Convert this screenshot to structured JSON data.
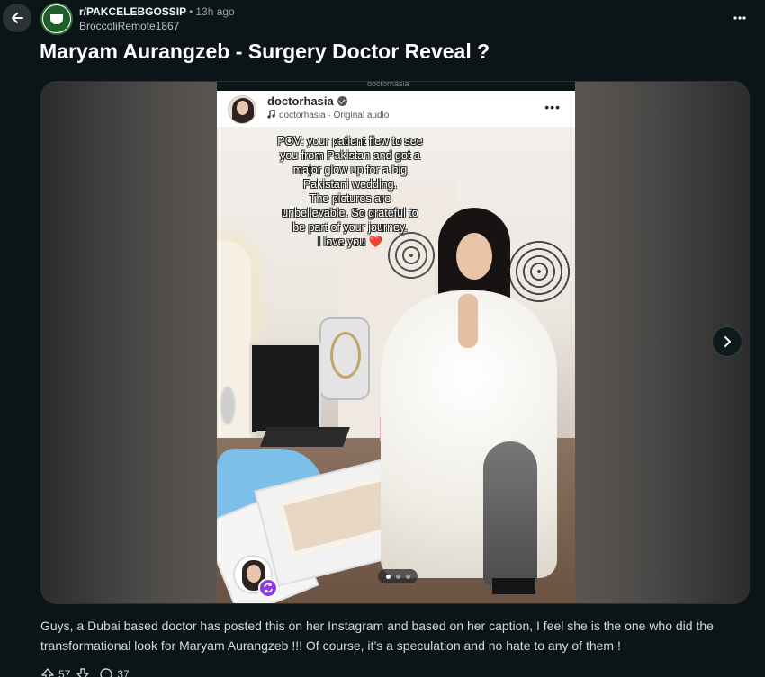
{
  "header": {
    "subreddit": "r/PAKCELEBGOSSIP",
    "separator": "•",
    "time": "13h ago",
    "author": "BroccoliRemote1867"
  },
  "post": {
    "title": "Maryam Aurangzeb - Surgery Doctor Reveal ?",
    "body": "Guys, a Dubai based doctor has posted this on her Instagram and based on her caption, I feel she is the one who did the transformational look for Maryam Aurangzeb !!! Of course, it’s a speculation and no hate to any of them !"
  },
  "media": {
    "top_label": "doctorhasia",
    "ig_username": "doctorhasia",
    "ig_audio": "doctorhasia · Original audio",
    "ig_more": "•••",
    "caption_lines": [
      "POV: your patient flew to see",
      "you from Pakistan and got a",
      "major glow up for a big",
      "Pakistani wedding.",
      "The pictures are",
      "unbelievable. So grateful to",
      "be part of your journey.",
      "I love you"
    ],
    "heart": "❤️",
    "carousel_total": 3,
    "carousel_active": 1
  },
  "actions": {
    "upvotes": "57",
    "comments": "37"
  },
  "colors": {
    "background": "#0b1416",
    "text": "#d7dadc",
    "muted": "#8ba2ad",
    "repost_badge": "#8f3ce6"
  },
  "icons": [
    "back-arrow-icon",
    "subreddit-avatar-icon",
    "more-options-icon",
    "verified-badge-icon",
    "music-note-icon",
    "chevron-right-icon",
    "repost-icon",
    "upvote-icon",
    "downvote-icon",
    "comment-icon"
  ]
}
